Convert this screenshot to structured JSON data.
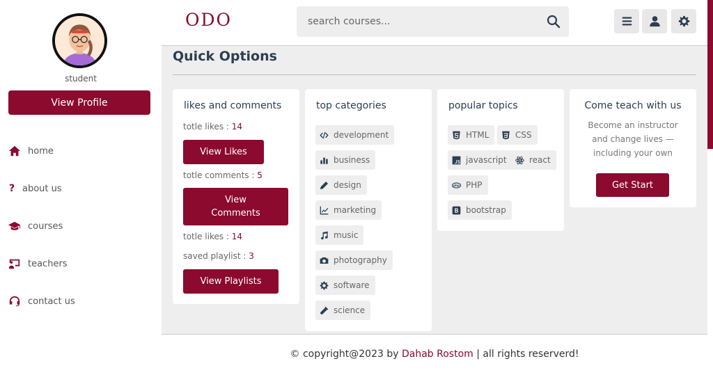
{
  "profile": {
    "role": "student",
    "view_profile": "View Profile"
  },
  "nav": [
    {
      "label": "home"
    },
    {
      "label": "about us"
    },
    {
      "label": "courses"
    },
    {
      "label": "teachers"
    },
    {
      "label": "contact us"
    }
  ],
  "header": {
    "logo": "ODO",
    "search_placeholder": "search courses..."
  },
  "main": {
    "title": "Quick Options",
    "likes_card": {
      "title": "likes and comments",
      "likes_label": "totle likes : ",
      "likes_value": "14",
      "view_likes": "View Likes",
      "comments_label": "totle comments : ",
      "comments_value": "5",
      "view_comments": "View Comments",
      "likes2_label": "totle likes : ",
      "likes2_value": "14",
      "saved_label": "saved playlist : ",
      "saved_value": "3",
      "view_playlists": "View Playlists"
    },
    "categories_card": {
      "title": "top categories",
      "items": [
        "development",
        "business",
        "design",
        "marketing",
        "music",
        "photography",
        "software",
        "science"
      ]
    },
    "topics_card": {
      "title": "popular topics",
      "items": [
        "HTML",
        "CSS",
        "javascript",
        "react",
        "PHP",
        "bootstrap"
      ]
    },
    "teach_card": {
      "title": "Come teach with us",
      "text": "Become an instructor and change lives — including your own",
      "button": "Get Start"
    }
  },
  "footer": {
    "prefix": "© copyright@2023 by ",
    "author": "Dahab Rostom",
    "suffix": " | all rights reserverd!"
  },
  "colors": {
    "accent": "#8b0a2e",
    "background": "#eeeeee",
    "text": "#2c3e50"
  }
}
